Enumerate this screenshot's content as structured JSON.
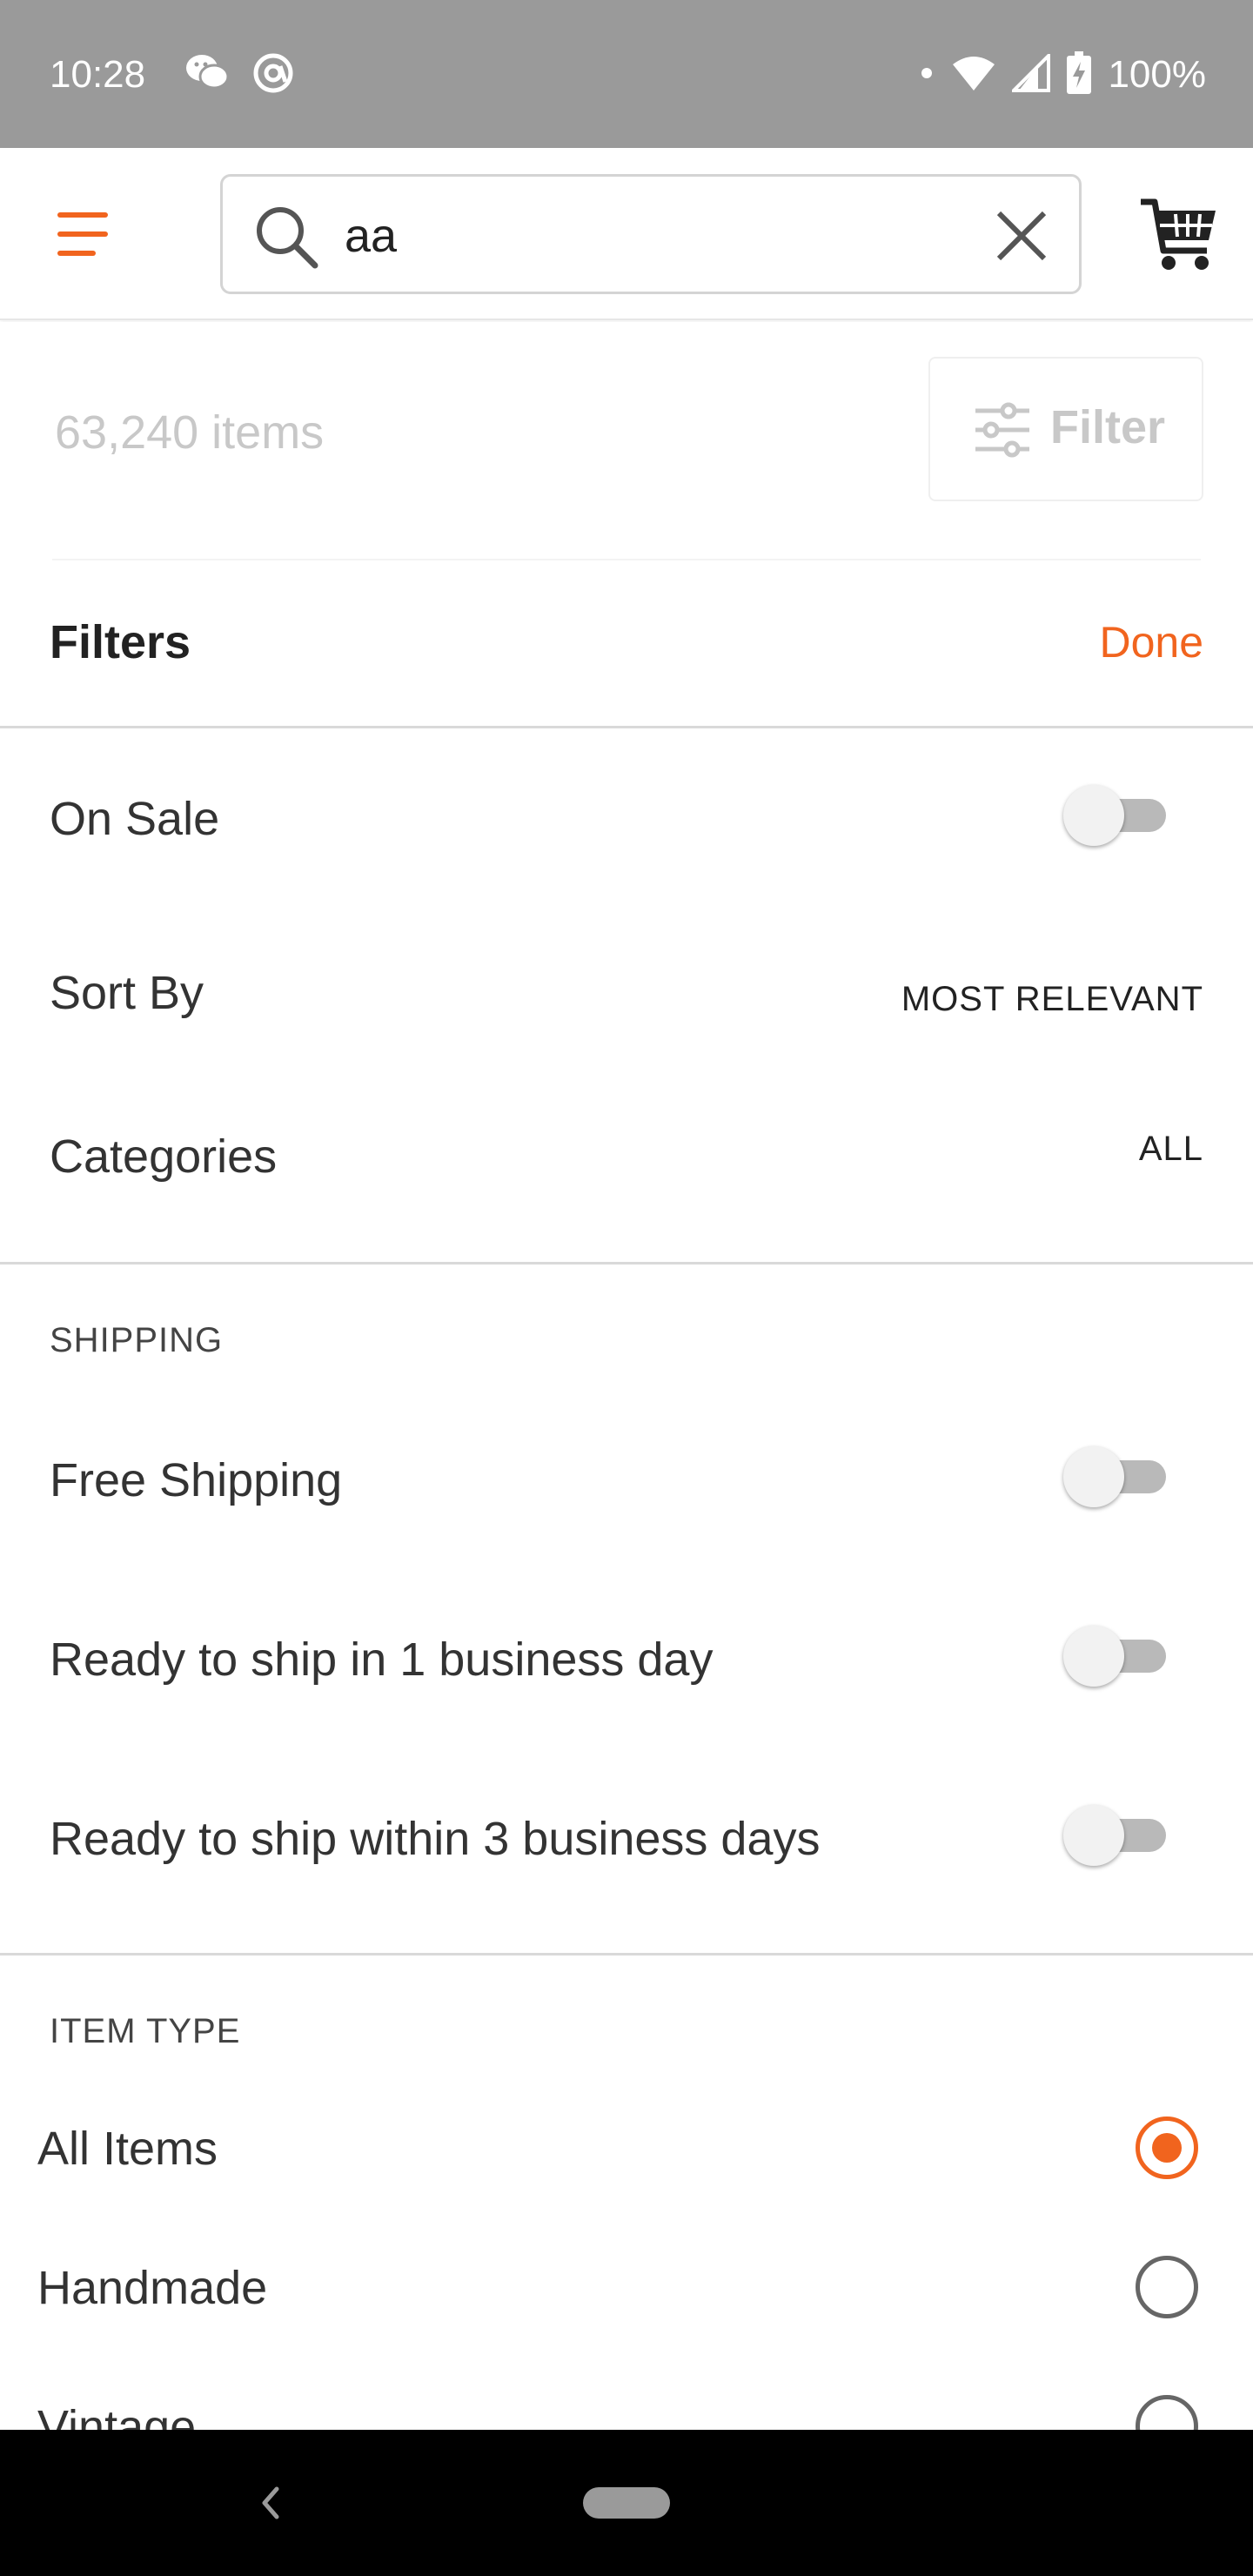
{
  "status_bar": {
    "time": "10:28",
    "battery": "100%",
    "icons_left": [
      "wechat-icon",
      "at-sign-icon"
    ],
    "icons_right": [
      "dot-icon",
      "wifi-icon",
      "signal-icon",
      "battery-charging-icon"
    ]
  },
  "header": {
    "search_value": "aa",
    "icons": [
      "menu-icon",
      "search-icon",
      "clear-icon",
      "cart-icon"
    ]
  },
  "results": {
    "count": "63,240 items",
    "filter_label": "Filter"
  },
  "filters": {
    "title": "Filters",
    "done_label": "Done",
    "on_sale": {
      "label": "On Sale",
      "enabled": false
    },
    "sort_by": {
      "label": "Sort By",
      "value": "MOST RELEVANT"
    },
    "categories": {
      "label": "Categories",
      "value": "ALL"
    }
  },
  "shipping": {
    "heading": "SHIPPING",
    "options": [
      {
        "label": "Free Shipping",
        "enabled": false
      },
      {
        "label": "Ready to ship in 1 business day",
        "enabled": false
      },
      {
        "label": "Ready to ship within 3 business days",
        "enabled": false
      }
    ]
  },
  "item_type": {
    "heading": "ITEM TYPE",
    "selected": "All Items",
    "options": [
      {
        "label": "All Items",
        "checked": true
      },
      {
        "label": "Handmade",
        "checked": false
      },
      {
        "label": "Vintage",
        "checked": false
      }
    ]
  },
  "colors": {
    "accent": "#f1641e",
    "status_bar": "#9a9a9a",
    "nav_bar": "#000000"
  }
}
